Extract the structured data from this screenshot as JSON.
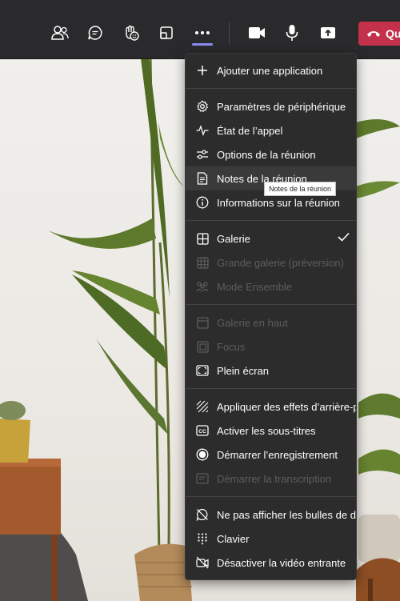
{
  "toolbar": {
    "items": [
      {
        "name": "participants-icon"
      },
      {
        "name": "chat-icon"
      },
      {
        "name": "reactions-icon"
      },
      {
        "name": "rooms-icon"
      },
      {
        "name": "more-actions-icon"
      },
      {
        "name": "camera-icon"
      },
      {
        "name": "microphone-icon"
      },
      {
        "name": "share-icon"
      }
    ],
    "hangup_label": "Qu",
    "accent_color": "#8b8cf0",
    "hangup_color": "#c4314b"
  },
  "menu": {
    "items": [
      {
        "label": "Ajouter une application",
        "icon": "plus-icon",
        "enabled": true
      },
      {
        "label": "Paramètres de périphérique",
        "icon": "gear-icon",
        "enabled": true
      },
      {
        "label": "État de l’appel",
        "icon": "pulse-icon",
        "enabled": true
      },
      {
        "label": "Options de la réunion",
        "icon": "options-icon",
        "enabled": true
      },
      {
        "label": "Notes de la réunion",
        "icon": "notes-icon",
        "enabled": true,
        "hovered": true
      },
      {
        "label": "Informations sur la réunion",
        "icon": "info-icon",
        "enabled": true
      },
      {
        "label": "Galerie",
        "icon": "gallery-icon",
        "enabled": true,
        "checked": true
      },
      {
        "label": "Grande galerie (préversion)",
        "icon": "large-gallery-icon",
        "enabled": false
      },
      {
        "label": "Mode Ensemble",
        "icon": "together-mode-icon",
        "enabled": false
      },
      {
        "label": "Galerie en haut",
        "icon": "gallery-top-icon",
        "enabled": false
      },
      {
        "label": "Focus",
        "icon": "focus-icon",
        "enabled": false
      },
      {
        "label": "Plein écran",
        "icon": "fullscreen-icon",
        "enabled": true
      },
      {
        "label": "Appliquer des effets d’arrière-p",
        "icon": "background-effects-icon",
        "enabled": true
      },
      {
        "label": "Activer les sous-titres",
        "icon": "captions-icon",
        "enabled": true
      },
      {
        "label": "Démarrer l’enregistrement",
        "icon": "record-icon",
        "enabled": true
      },
      {
        "label": "Démarrer la transcription",
        "icon": "transcript-icon",
        "enabled": false
      },
      {
        "label": "Ne pas afficher les bulles de di",
        "icon": "hide-bubbles-icon",
        "enabled": true
      },
      {
        "label": "Clavier",
        "icon": "keypad-icon",
        "enabled": true
      },
      {
        "label": "Désactiver la vidéo entrante",
        "icon": "video-off-icon",
        "enabled": true
      }
    ]
  },
  "tooltip": {
    "text": "Notes de la réunion"
  }
}
